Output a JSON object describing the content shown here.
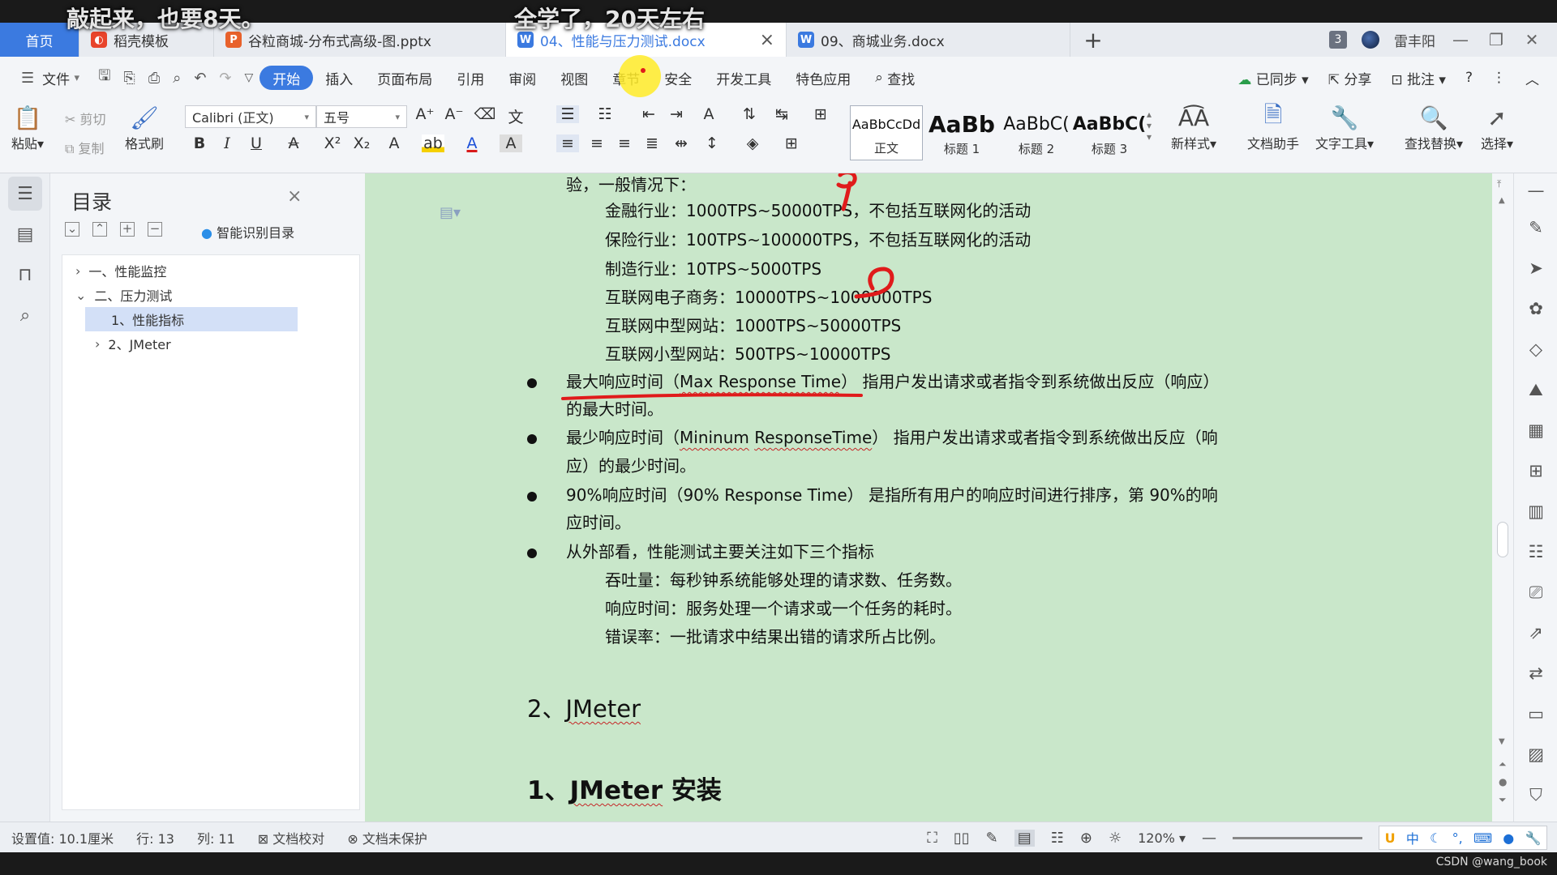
{
  "overlay": {
    "left_caption": "敲起来，也要8天。",
    "center_caption": "全学了，20天左右"
  },
  "tabs": {
    "home": "首页",
    "daoke": "稻壳模板",
    "pptx": "谷粒商城-分布式高级-图.pptx",
    "active": "04、性能与压力测试.docx",
    "file09": "09、商城业务.docx",
    "add": "+",
    "window_count": "3",
    "user": "雷丰阳"
  },
  "menu": {
    "file": "文件",
    "items": [
      "开始",
      "插入",
      "页面布局",
      "引用",
      "审阅",
      "视图",
      "章节",
      "安全",
      "开发工具",
      "特色应用"
    ],
    "search": "查找",
    "synced": "已同步",
    "share": "分享",
    "comment": "批注"
  },
  "ribbon": {
    "paste": "粘贴",
    "cut": "剪切",
    "copy": "复制",
    "format_painter": "格式刷",
    "font_name": "Calibri (正文)",
    "font_size": "五号",
    "styles": [
      {
        "sample": "AaBbCcDd",
        "name": "正文"
      },
      {
        "sample": "AaBb",
        "name": "标题 1"
      },
      {
        "sample": "AaBbC(",
        "name": "标题 2"
      },
      {
        "sample": "AaBbC(",
        "name": "标题 3"
      }
    ],
    "new_style": "新样式",
    "doc_assistant": "文档助手",
    "text_tools": "文字工具",
    "find_replace": "查找替换",
    "select": "选择"
  },
  "toc": {
    "title": "目录",
    "smart": "智能识别目录",
    "items": [
      {
        "label": "一、性能监控"
      },
      {
        "label": "二、压力测试"
      },
      {
        "label": "1、性能指标"
      },
      {
        "label": "2、JMeter"
      }
    ]
  },
  "doc": {
    "l0": "验，一般情况下：",
    "l1": "金融行业：1000TPS~50000TPS，不包括互联网化的活动",
    "l2": "保险行业：100TPS~100000TPS，不包括互联网化的活动",
    "l3": "制造行业：10TPS~5000TPS",
    "l4": "互联网电子商务：10000TPS~1000000TPS",
    "l5": "互联网中型网站：1000TPS~50000TPS",
    "l6": "互联网小型网站：500TPS~10000TPS",
    "max_a": "最大响应时间（",
    "max_b": "Max Response Time",
    "max_c": "）",
    "max_d": " 指用户发出请求或者指令到系统做出反应（响应）",
    "max_e": "的最大时间。",
    "min_a": "最少响应时间（",
    "min_b": "Mininum",
    "min_c": " ",
    "min_d": "ResponseTime",
    "min_e": "） 指用户发出请求或者指令到系统做出反应（响",
    "min_f": "应）的最少时间。",
    "p90_a": "90%响应时间（90% Response Time） 是指所有用户的响应时间进行排序，第 90%的响",
    "p90_b": "应时间。",
    "out": "从外部看，性能测试主要关注如下三个指标",
    "o1": "吞吐量：每秒钟系统能够处理的请求数、任务数。",
    "o2": "响应时间：服务处理一个请求或一个任务的耗时。",
    "o3": "错误率：一批请求中结果出错的请求所占比例。",
    "h2_num": "2、",
    "h2_word": "JMeter",
    "h1_num": "1、",
    "h1_word": "JMeter",
    "h1_rest": " 安装"
  },
  "status": {
    "setting": "设置值: 10.1厘米",
    "row": "行: 13",
    "col": "列: 11",
    "proof": "文档校对",
    "protect": "文档未保护",
    "zoom": "120%",
    "ime": "中"
  },
  "watermark": "CSDN @wang_book",
  "colors": {
    "accent": "#3b7ae0",
    "doc_bg": "#c9e7ca",
    "annotation_red": "#e01b1b"
  }
}
